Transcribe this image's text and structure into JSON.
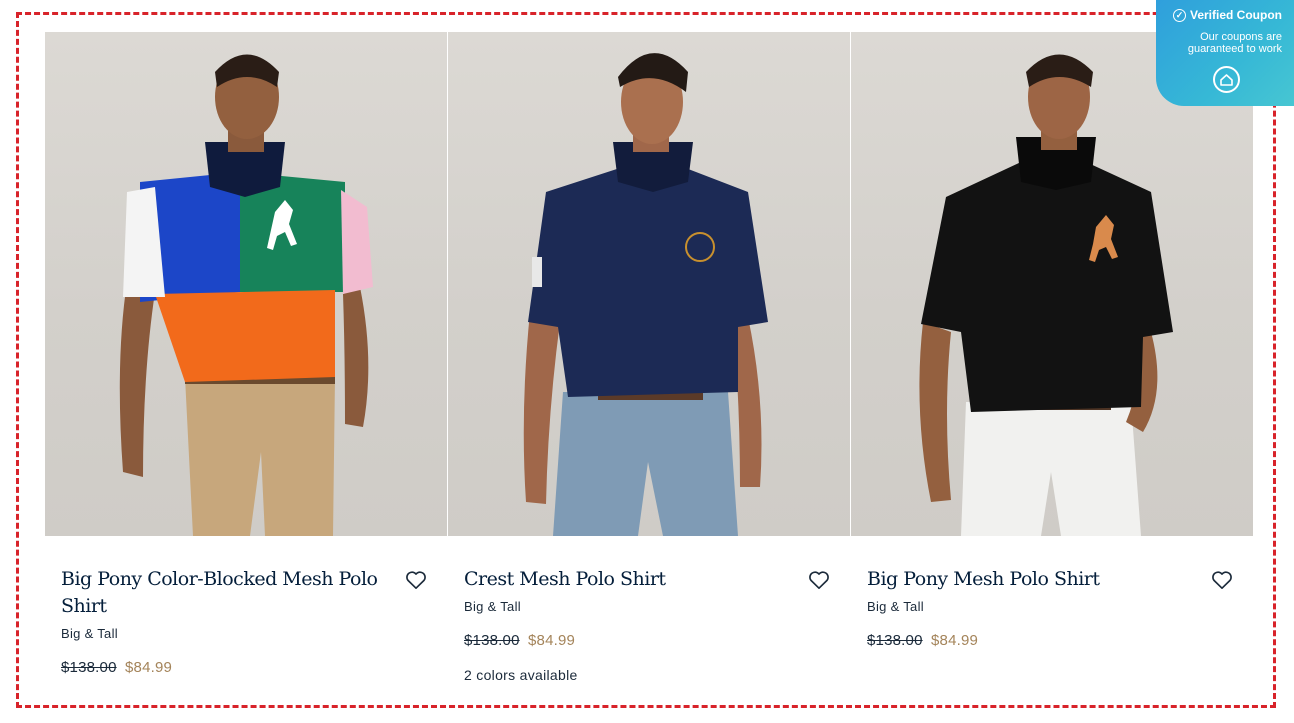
{
  "products": [
    {
      "title": "Big Pony Color-Blocked Mesh Polo Shirt",
      "subtitle": "Big & Tall",
      "original_price": "$138.00",
      "sale_price": "$84.99",
      "colors_note": "",
      "image": "man-in-color-blocked-polo-khaki-pants"
    },
    {
      "title": "Crest Mesh Polo Shirt",
      "subtitle": "Big & Tall",
      "original_price": "$138.00",
      "sale_price": "$84.99",
      "colors_note": "2 colors available",
      "image": "man-in-navy-polo-jeans"
    },
    {
      "title": "Big Pony Mesh Polo Shirt",
      "subtitle": "Big & Tall",
      "original_price": "$138.00",
      "sale_price": "$84.99",
      "colors_note": "",
      "image": "man-in-black-polo-white-pants"
    }
  ],
  "coupon_badge": {
    "title": "Verified Coupon",
    "message_line1": "Our coupons are",
    "message_line2": "guaranteed to work",
    "icon": "check-circle-icon",
    "logo_icon": "house-logo-icon"
  },
  "colors": {
    "highlight_border": "#d8232a",
    "title": "#041e3a",
    "sale_price": "#a4845a",
    "coupon_bg": "#36b8d6"
  }
}
